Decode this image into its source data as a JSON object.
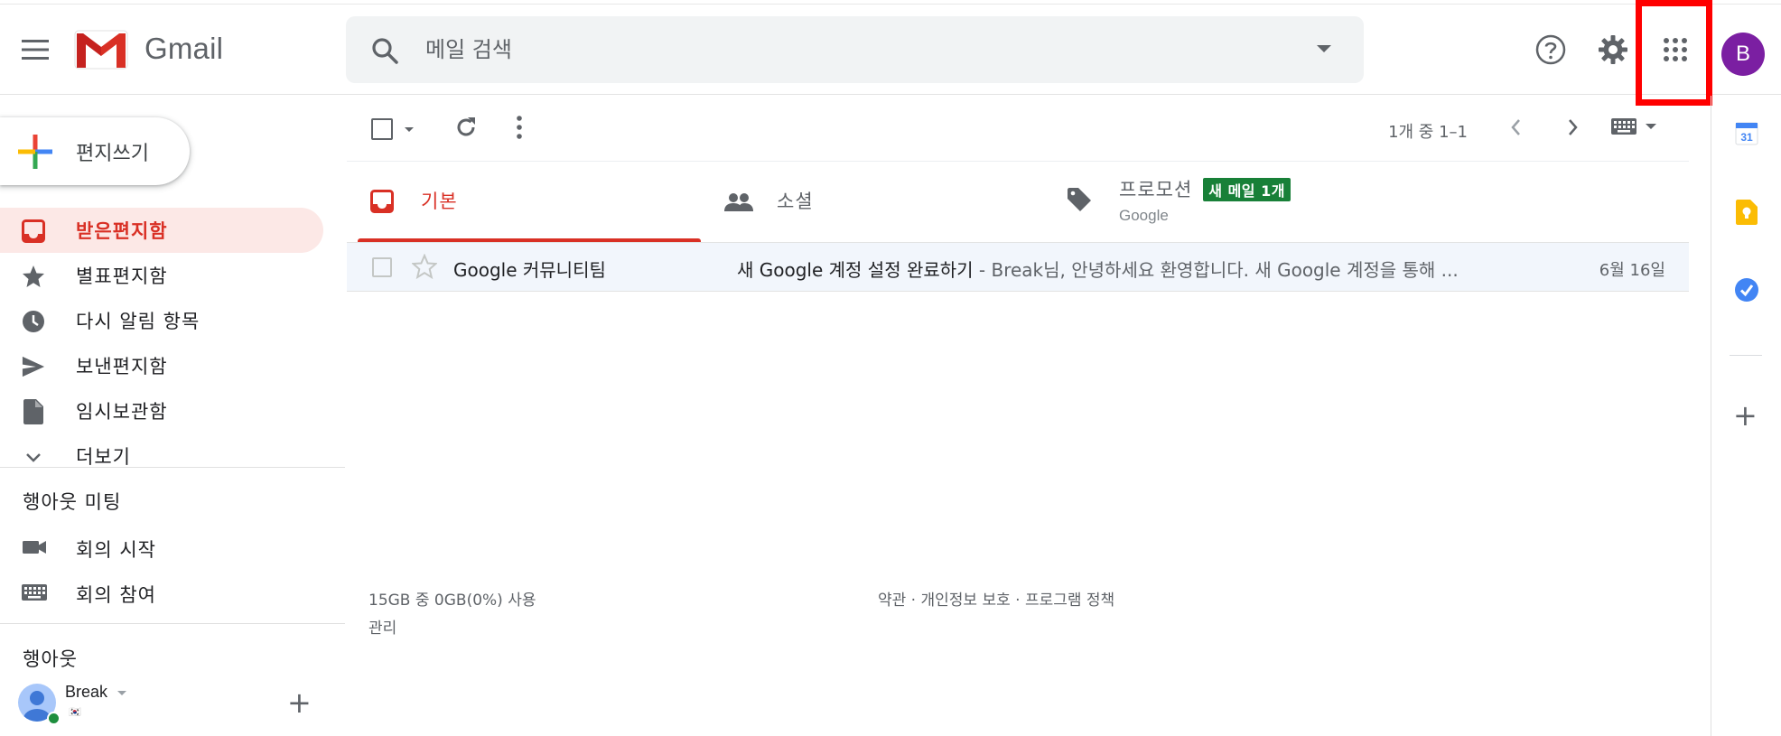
{
  "header": {
    "app_name": "Gmail",
    "search_placeholder": "메일 검색",
    "avatar_letter": "B",
    "brand_color": "#ea4335",
    "avatar_color": "#7b1fa2",
    "icons": [
      "menu-icon",
      "search-icon",
      "help-icon",
      "gear-icon",
      "apps-grid-icon"
    ]
  },
  "compose": {
    "label": "편지쓰기"
  },
  "nav": {
    "items": [
      {
        "label": "받은편지함",
        "icon": "inbox-icon",
        "active": true
      },
      {
        "label": "별표편지함",
        "icon": "star-icon",
        "active": false
      },
      {
        "label": "다시 알림 항목",
        "icon": "clock-icon",
        "active": false
      },
      {
        "label": "보낸편지함",
        "icon": "send-icon",
        "active": false
      },
      {
        "label": "임시보관함",
        "icon": "draft-icon",
        "active": false
      },
      {
        "label": "더보기",
        "icon": "chevron-down-icon",
        "active": false
      }
    ]
  },
  "meet": {
    "title": "행아웃 미팅",
    "items": [
      {
        "label": "회의 시작",
        "icon": "video-icon"
      },
      {
        "label": "회의 참여",
        "icon": "keyboard-icon"
      }
    ]
  },
  "hangouts": {
    "title": "행아웃",
    "user_name": "Break",
    "flag": "🇰🇷"
  },
  "toolbar": {
    "pagination": "1개 중 1–1"
  },
  "tabs": [
    {
      "label": "기본",
      "icon": "inbox-icon",
      "active": true
    },
    {
      "label": "소셜",
      "icon": "people-icon",
      "active": false
    },
    {
      "label": "프로모션",
      "icon": "tag-icon",
      "active": false,
      "badge": "새 메일 1개",
      "subtitle": "Google"
    }
  ],
  "mails": [
    {
      "sender": "Google 커뮤니티팀",
      "subject": "새 Google 계정 설정 완료하기",
      "snippet": " - Break님, 안녕하세요 환영합니다. 새 Google 계정을 통해 ...",
      "date": "6월 16일"
    }
  ],
  "footer": {
    "storage": "15GB 중 0GB(0%) 사용",
    "manage": "관리",
    "links": "약관 · 개인정보 보호 · 프로그램 정책"
  },
  "side_panel": {
    "items": [
      "calendar-icon",
      "keep-icon",
      "tasks-icon",
      "add-icon"
    ],
    "calendar_day": "31"
  }
}
